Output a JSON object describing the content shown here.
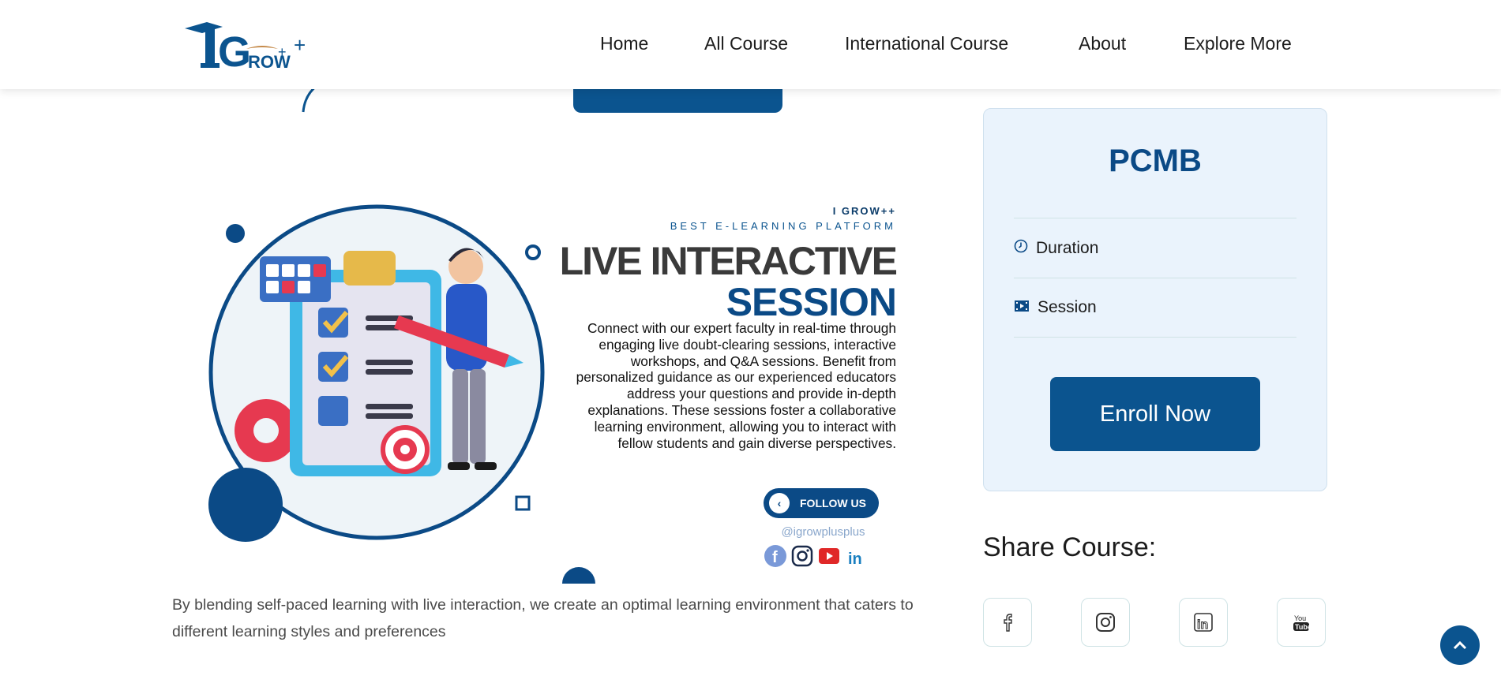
{
  "header": {
    "logo_text": "IGROW++",
    "nav": [
      {
        "label": "Home"
      },
      {
        "label": "All Course"
      },
      {
        "label": "International Course"
      },
      {
        "label": "About"
      },
      {
        "label": "Explore More"
      }
    ]
  },
  "banner": {
    "brand": "I GROW++",
    "tagline": "BEST E-LEARNING PLATFORM",
    "title_line1": "LIVE INTERACTIVE",
    "title_line2": "SESSION",
    "description": "Connect with our expert faculty in real-time through engaging live doubt-clearing sessions, interactive workshops, and Q&A sessions. Benefit from personalized guidance as our experienced educators address your questions and provide in-depth explanations. These sessions foster a collaborative learning environment, allowing you to interact  with fellow students and gain diverse perspectives.",
    "follow_label": "FOLLOW US",
    "handle": "@igrowplusplus",
    "social_icons": [
      "facebook-icon",
      "instagram-icon",
      "youtube-icon",
      "linkedin-icon"
    ]
  },
  "content": {
    "blend_text": "By blending self-paced learning with live interaction, we create an optimal learning environment that caters to different learning styles and preferences"
  },
  "course_card": {
    "title": "PCMB",
    "rows": [
      {
        "icon": "clock-icon",
        "label": "Duration"
      },
      {
        "icon": "film-icon",
        "label": "Session"
      }
    ],
    "enroll_label": "Enroll Now"
  },
  "share": {
    "title": "Share Course:",
    "icons": [
      "facebook-icon",
      "instagram-icon",
      "linkedin-icon",
      "youtube-icon"
    ]
  },
  "colors": {
    "primary": "#0b548f",
    "card_bg": "#eaf3fc",
    "accent_red": "#e63950"
  }
}
